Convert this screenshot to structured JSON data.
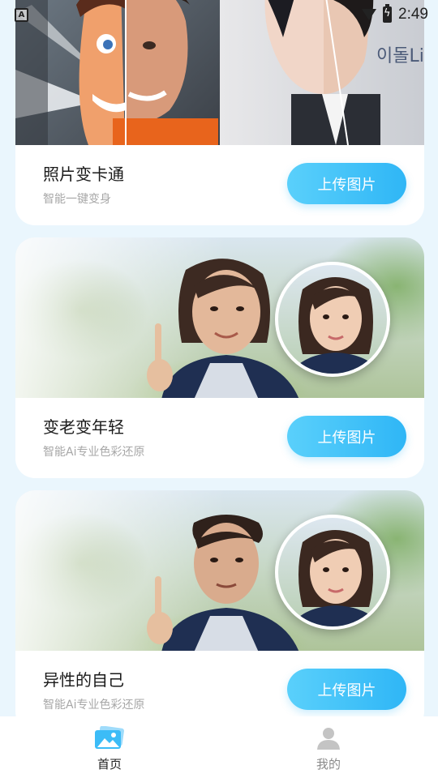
{
  "status_bar": {
    "time": "2:49",
    "notification_glyph": "A",
    "icons": [
      "notification-a-icon",
      "signal-icon",
      "battery-charging-icon"
    ]
  },
  "cards": [
    {
      "title": "照片变卡通",
      "subtitle": "智能一键变身",
      "button_label": "上传图片",
      "image_desc": "half cartoon / half photo portraits"
    },
    {
      "title": "变老变年轻",
      "subtitle": "智能Ai专业色彩还原",
      "button_label": "上传图片",
      "image_desc": "aged woman with young woman inset"
    },
    {
      "title": "异性的自己",
      "subtitle": "智能Ai专业色彩还原",
      "button_label": "上传图片",
      "image_desc": "man version with young woman inset"
    }
  ],
  "bottom_nav": {
    "items": [
      {
        "label": "首页",
        "icon": "photos-icon",
        "active": true
      },
      {
        "label": "我的",
        "icon": "user-icon",
        "active": false
      }
    ]
  },
  "colors": {
    "accent": "#2fb6f6",
    "background": "#eaf6fd",
    "card": "#ffffff"
  }
}
